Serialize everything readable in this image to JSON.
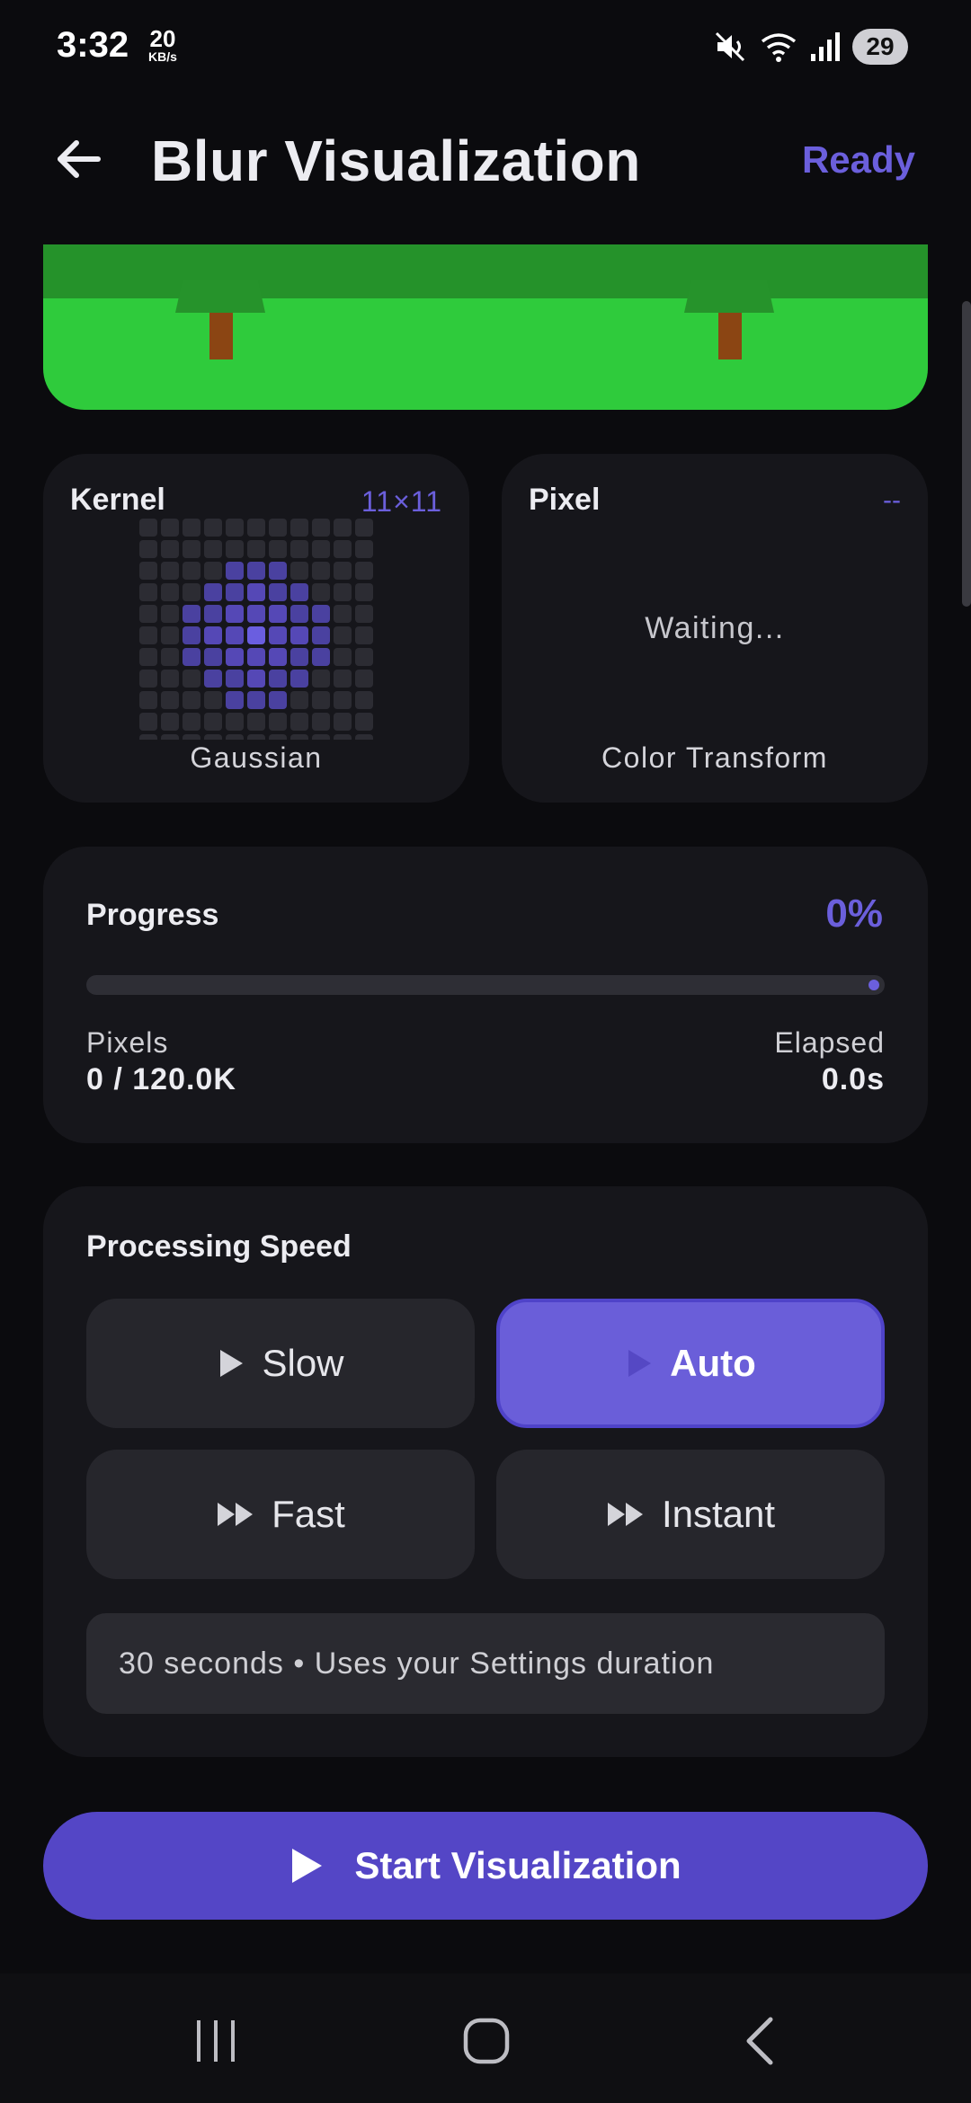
{
  "status_bar": {
    "time": "3:32",
    "net_speed": "20",
    "net_unit": "KB/s",
    "battery": "29"
  },
  "app_bar": {
    "title": "Blur Visualization",
    "status": "Ready"
  },
  "kernel": {
    "label": "Kernel",
    "size": "11×11",
    "type": "Gaussian"
  },
  "pixel": {
    "label": "Pixel",
    "value": "--",
    "waiting": "Waiting...",
    "caption": "Color Transform"
  },
  "progress": {
    "label": "Progress",
    "percent_text": "0%",
    "fraction": 0,
    "pixels_label": "Pixels",
    "pixels_value": "0 / 120.0K",
    "elapsed_label": "Elapsed",
    "elapsed_value": "0.0s"
  },
  "speed": {
    "label": "Processing Speed",
    "options": [
      {
        "label": "Slow",
        "icon": "play-icon",
        "selected": false
      },
      {
        "label": "Auto",
        "icon": "play-icon",
        "selected": true
      },
      {
        "label": "Fast",
        "icon": "fast-forward-icon",
        "selected": false
      },
      {
        "label": "Instant",
        "icon": "fast-forward-icon",
        "selected": false
      }
    ],
    "hint": "30 seconds • Uses your Settings duration"
  },
  "start_button": {
    "label": "Start Visualization"
  },
  "colors": {
    "accent": "#6b5fdc",
    "start_button": "#5446c6",
    "scene_grass": "#2fcb3c",
    "scene_trees": "#25922a",
    "trunk": "#8b4513"
  }
}
